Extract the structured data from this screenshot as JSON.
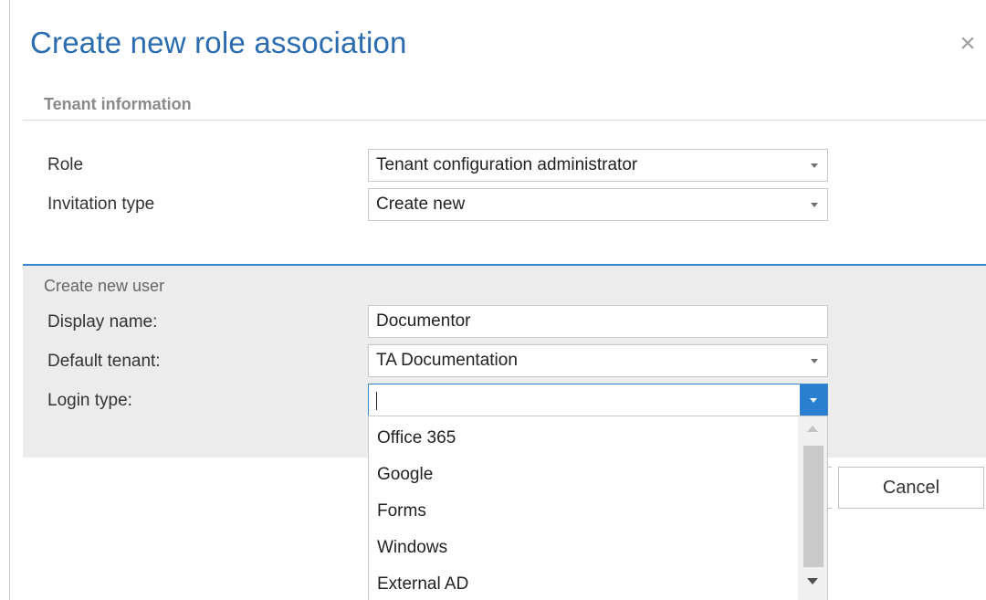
{
  "dialog": {
    "title": "Create new role association",
    "close_glyph": "×",
    "section_title": "Tenant information"
  },
  "tenant": {
    "role_label": "Role",
    "role_value": "Tenant configuration administrator",
    "invitation_label": "Invitation type",
    "invitation_value": "Create new"
  },
  "new_user": {
    "section_title": "Create new user",
    "display_name_label": "Display name:",
    "display_name_value": "Documentor",
    "default_tenant_label": "Default tenant:",
    "default_tenant_value": "TA Documentation",
    "login_type_label": "Login type:",
    "login_type_value": "",
    "login_type_options": [
      "Office 365",
      "Google",
      "Forms",
      "Windows",
      "External AD"
    ]
  },
  "buttons": {
    "cancel_label": "Cancel"
  },
  "colors": {
    "title": "#2b6cb0",
    "accent": "#2b7fd1",
    "panel_bg": "#ececec"
  },
  "icons": {
    "close": "close-icon",
    "dropdown": "chevron-down-icon",
    "scroll_up": "scroll-up-icon",
    "scroll_down": "scroll-down-icon"
  }
}
